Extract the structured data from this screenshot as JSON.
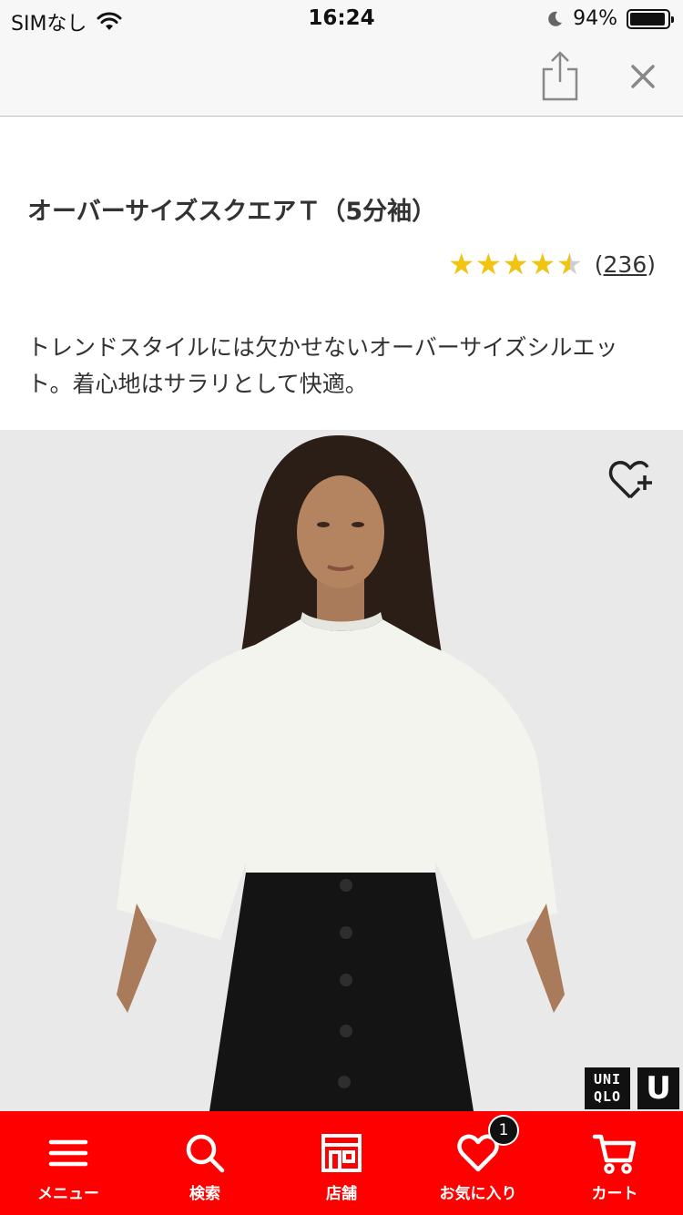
{
  "status_bar": {
    "carrier": "SIMなし",
    "time": "16:24",
    "battery_percent": "94%",
    "battery_level": 0.94
  },
  "nav": {
    "share_icon": "share-icon",
    "close_icon": "close-icon"
  },
  "product": {
    "title": "オーバーサイズスクエアＴ（5分袖）",
    "rating": 4.5,
    "rating_max": 5,
    "stars_glyphs": "★★★★★",
    "review_open": "(",
    "review_count": "236",
    "review_close": ")",
    "description": "トレンドスタイルには欠かせないオーバーサイズシルエット。着心地はサラリとして快適。"
  },
  "image": {
    "favorite_icon": "heart-plus-icon",
    "logo_uniqlo_line1": "UNI",
    "logo_uniqlo_line2": "QLO",
    "logo_u": "U"
  },
  "tabs": [
    {
      "label": "メニュー",
      "icon": "menu-icon"
    },
    {
      "label": "検索",
      "icon": "search-icon"
    },
    {
      "label": "店舗",
      "icon": "store-icon"
    },
    {
      "label": "お気に入り",
      "icon": "heart-icon",
      "badge": "1"
    },
    {
      "label": "カート",
      "icon": "cart-icon"
    }
  ],
  "colors": {
    "accent": "#ff0000",
    "star": "#f1c40f",
    "image_bg": "#e9e9e9"
  }
}
